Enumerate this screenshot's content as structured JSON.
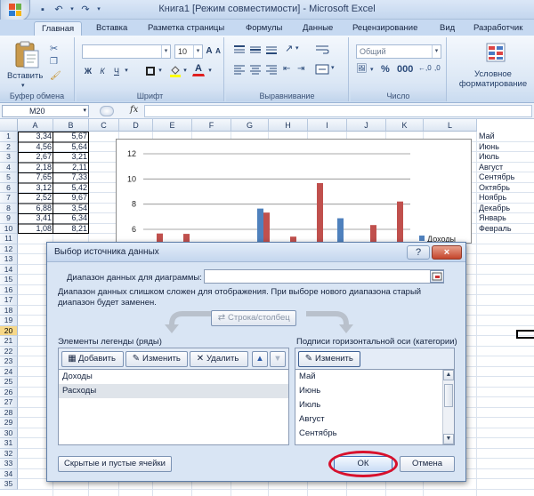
{
  "window_title": "Книга1  [Режим совместимости] - Microsoft Excel",
  "tabs": [
    "Главная",
    "Вставка",
    "Разметка страницы",
    "Формулы",
    "Данные",
    "Рецензирование",
    "Вид",
    "Разработчик"
  ],
  "ribbon": {
    "paste_label": "Вставить",
    "font_size": "10",
    "number_format": "Общий",
    "cond_format_line1": "Условное",
    "cond_format_line2": "форматирование",
    "groups": [
      "Буфер обмена",
      "Шрифт",
      "Выравнивание",
      "Число"
    ]
  },
  "formula_bar": {
    "name_box": "M20",
    "fx": "fx"
  },
  "columns": [
    "A",
    "B",
    "C",
    "D",
    "E",
    "F",
    "G",
    "H",
    "I",
    "J",
    "K",
    "L"
  ],
  "rows": [
    "1",
    "2",
    "3",
    "4",
    "5",
    "6",
    "7",
    "8",
    "9",
    "10",
    "11",
    "12",
    "13",
    "14",
    "15",
    "16",
    "17",
    "18",
    "19",
    "20",
    "21",
    "22",
    "23",
    "24",
    "25",
    "26",
    "27",
    "28",
    "29",
    "30",
    "31",
    "32",
    "33",
    "34",
    "35"
  ],
  "selected_row": "20",
  "col_a": [
    "3,34",
    "4,56",
    "2,67",
    "2,18",
    "7,65",
    "3,12",
    "2,52",
    "6,88",
    "3,41",
    "1,08"
  ],
  "col_b": [
    "5,67",
    "5,64",
    "3,21",
    "2,11",
    "7,33",
    "5,42",
    "9,67",
    "3,54",
    "6,34",
    "8,21"
  ],
  "col_l": [
    "Май",
    "Июнь",
    "Июль",
    "Август",
    "Сентябрь",
    "Октябрь",
    "Ноябрь",
    "Декабрь",
    "Январь",
    "Февраль"
  ],
  "chart_data": {
    "type": "bar",
    "categories": [
      "Май",
      "Июнь",
      "Июль",
      "Август",
      "Сентябрь",
      "Октябрь",
      "Ноябрь",
      "Декабрь",
      "Январь",
      "Февраль"
    ],
    "series": [
      {
        "name": "Доходы",
        "values": [
          3.34,
          4.56,
          2.67,
          2.18,
          7.65,
          3.12,
          2.52,
          6.88,
          3.41,
          1.08
        ],
        "color": "#4f81bd"
      },
      {
        "name": "Расходы",
        "values": [
          5.67,
          5.64,
          3.21,
          2.11,
          7.33,
          5.42,
          9.67,
          3.54,
          6.34,
          8.21
        ],
        "color": "#c0504d"
      }
    ],
    "yticks": [
      "6",
      "8",
      "10",
      "12"
    ],
    "legend_visible": "Доходы"
  },
  "dialog": {
    "title": "Выбор источника данных",
    "range_label": "Диапазон данных для диаграммы:",
    "range_value": "",
    "note": "Диапазон данных слишком сложен для отображения. При выборе нового диапазона старый диапазон будет заменен.",
    "switch_label": "Строка/столбец",
    "legend_label": "Элементы легенды (ряды)",
    "add_label": "Добавить",
    "edit_label": "Изменить",
    "delete_label": "Удалить",
    "series_items": [
      "Доходы",
      "Расходы"
    ],
    "axis_label": "Подписи горизонтальной оси (категории)",
    "axis_edit_label": "Изменить",
    "axis_items": [
      "Май",
      "Июнь",
      "Июль",
      "Август",
      "Сентябрь"
    ],
    "hidden_cells_label": "Скрытые и пустые ячейки",
    "ok_label": "ОК",
    "cancel_label": "Отмена",
    "help": "?",
    "close": "×"
  },
  "colors": {
    "accent": "#c0504d",
    "highlight_circle": "#d8102c",
    "ribbon": "#dbe7f5"
  }
}
